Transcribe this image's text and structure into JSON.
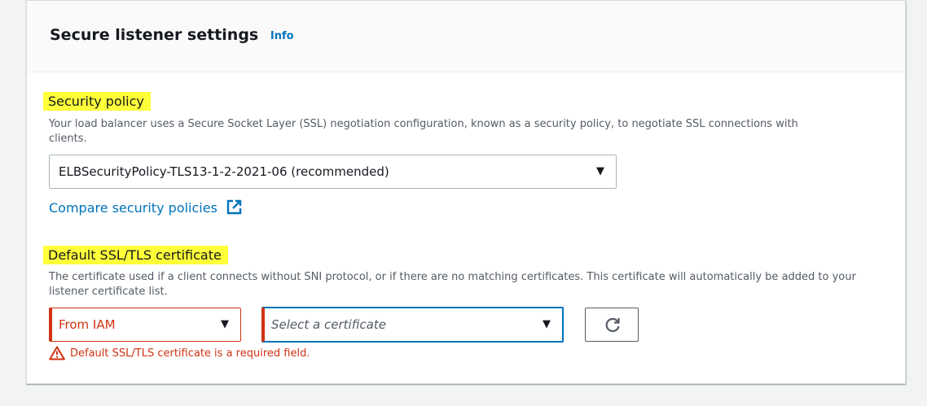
{
  "header": {
    "title": "Secure listener settings",
    "info_link": "Info"
  },
  "security_policy": {
    "label": "Security policy",
    "description": "Your load balancer uses a Secure Socket Layer (SSL) negotiation configuration, known as a security policy, to negotiate SSL connections with clients.",
    "selected_value": "ELBSecurityPolicy-TLS13-1-2-2021-06 (recommended)",
    "compare_link": "Compare security policies"
  },
  "certificate": {
    "label": "Default SSL/TLS certificate",
    "description": "The certificate used if a client connects without SNI protocol, or if there are no matching certificates. This certificate will automatically be added to your listener certificate list.",
    "source_value": "From IAM",
    "cert_placeholder": "Select a certificate",
    "error_message": "Default SSL/TLS certificate is a required field."
  },
  "colors": {
    "link": "#0073bb",
    "error": "#d13212",
    "highlight": "#ffff3a",
    "focus": "#0073bb"
  },
  "icons": {
    "external": "external-link-icon",
    "refresh": "refresh-icon",
    "caret": "caret-down-icon",
    "warning": "warning-icon"
  }
}
